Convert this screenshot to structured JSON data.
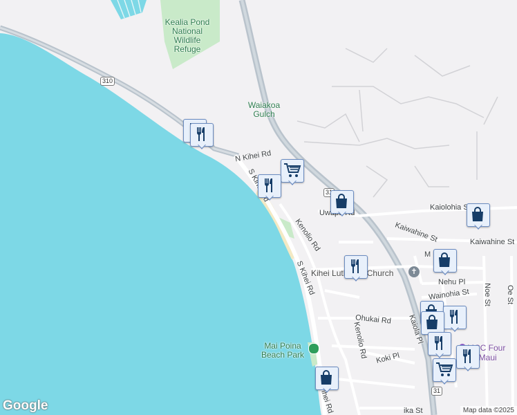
{
  "map": {
    "colors": {
      "water": "#7dd8e6",
      "land": "#f2f1f3",
      "park": "#c9eac9",
      "highway": "#b9c3cc",
      "road": "#ffffff",
      "sand": "#f3e9c4",
      "marker_fill": "#e8f0fb",
      "marker_icon": "#163d68"
    },
    "parks": [
      {
        "name": "Kealia Pond National Wildlife Refuge",
        "lines": [
          "Kealia Pond",
          "National",
          "Wildlife",
          "Refuge"
        ]
      },
      {
        "name": "Mai Poina Beach Park",
        "lines": [
          "Mai Poina",
          "Beach Park"
        ]
      }
    ],
    "places": {
      "gulch_lines": [
        "Waiakoa",
        "Gulch"
      ],
      "church": "Kihei Lutheran Church",
      "college": "UHMCC Foundation and Maui"
    },
    "college_lines": [
      "MCC Four",
      "nd Maui"
    ],
    "roads": {
      "n_kihei": "N Kihei Rd",
      "s_kihei_upper": "S Kihei Rd",
      "s_kihei_mid": "S Kihei Rd",
      "s_kihei_lower": "ihei Rd",
      "kenolio_upper": "Kenolio Rd",
      "kenolio_lower": "Kenolio Rd",
      "uwapo": "Uwapo Rd",
      "kaiolohia": "Kaiolohia St",
      "kaiwahine_w": "Kaiwahine St",
      "kaiwahine_e": "Kaiwahine St",
      "nehu": "Nehu Pl",
      "wainohia": "Wainohia St",
      "ohukai": "Ohukai Rd",
      "kaiola": "Kaiola Pl",
      "koki": "Koki Pl",
      "noe": "Noe St",
      "oe": "Oe St",
      "mi": "M",
      "lika": "ika St"
    },
    "shields": [
      "310",
      "31",
      "31"
    ],
    "markers": [
      {
        "type": "restaurant-icon"
      },
      {
        "type": "restaurant-icon"
      },
      {
        "type": "grocery-cart-icon"
      },
      {
        "type": "restaurant-icon"
      },
      {
        "type": "shopping-bag-icon"
      },
      {
        "type": "shopping-bag-icon"
      },
      {
        "type": "shopping-bag-icon"
      },
      {
        "type": "restaurant-icon"
      },
      {
        "type": "shopping-bag-icon"
      },
      {
        "type": "restaurant-icon"
      },
      {
        "type": "shopping-bag-icon"
      },
      {
        "type": "restaurant-icon"
      },
      {
        "type": "restaurant-icon"
      },
      {
        "type": "grocery-cart-icon"
      },
      {
        "type": "shopping-bag-icon"
      }
    ],
    "logo": "Google",
    "attribution": "Map data ©2025"
  }
}
